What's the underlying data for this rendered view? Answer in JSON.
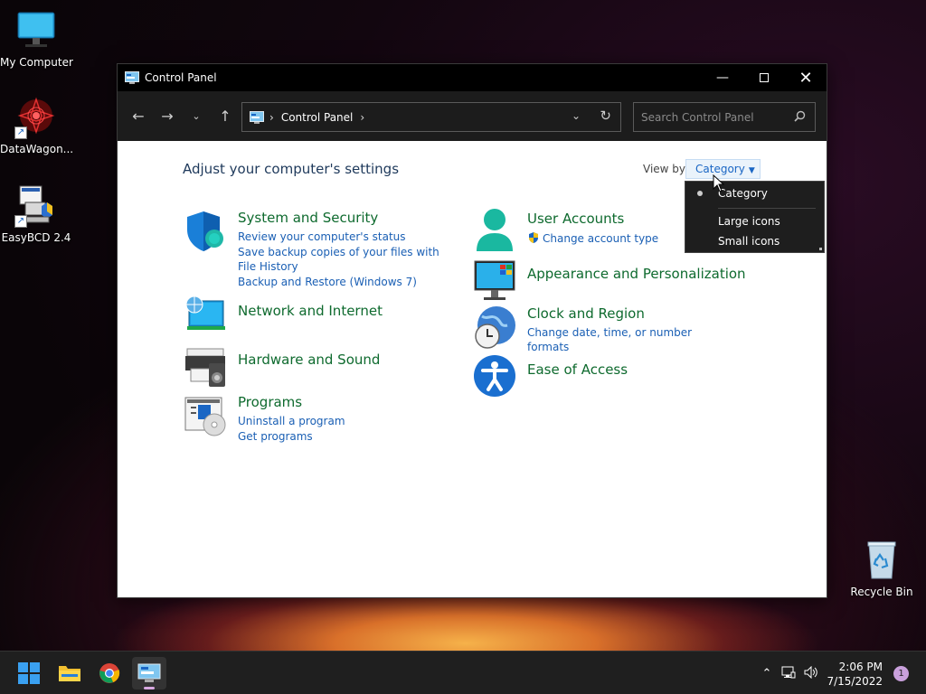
{
  "desktop": {
    "icons": [
      {
        "label": "My Computer"
      },
      {
        "label": "DataWagon..."
      },
      {
        "label": "EasyBCD 2.4"
      },
      {
        "label": "Recycle Bin"
      }
    ]
  },
  "window": {
    "title": "Control Panel",
    "address": {
      "crumb": "Control Panel"
    },
    "search": {
      "placeholder": "Search Control Panel"
    },
    "heading": "Adjust your computer's settings",
    "view_by": {
      "label": "View by:",
      "selected": "Category"
    },
    "categories": [
      {
        "title": "System and Security",
        "icon": "shield-icon",
        "links": [
          "Review your computer's status",
          "Save backup copies of your files with File History",
          "Backup and Restore (Windows 7)"
        ]
      },
      {
        "title": "Network and Internet",
        "icon": "network-globe-icon",
        "links": []
      },
      {
        "title": "Hardware and Sound",
        "icon": "printer-speaker-icon",
        "links": []
      },
      {
        "title": "Programs",
        "icon": "programs-disc-icon",
        "links": [
          "Uninstall a program",
          "Get programs"
        ]
      },
      {
        "title": "User Accounts",
        "icon": "user-icon",
        "links": [
          "Change account type"
        ]
      },
      {
        "title": "Appearance and Personalization",
        "icon": "monitor-palette-icon",
        "links": []
      },
      {
        "title": "Clock and Region",
        "icon": "clock-globe-icon",
        "links": [
          "Change date, time, or number formats"
        ]
      },
      {
        "title": "Ease of Access",
        "icon": "accessibility-icon",
        "links": []
      }
    ]
  },
  "view_menu": {
    "items": [
      "Category",
      "Large icons",
      "Small icons"
    ],
    "selected_index": 0
  },
  "taskbar": {
    "clock": {
      "time": "2:06 PM",
      "date": "7/15/2022"
    },
    "notifications": "1"
  },
  "colors": {
    "link": "#1a5fb4",
    "category_title": "#0e6a2e",
    "heading": "#1e395b",
    "titlebar": "#000000",
    "navbar": "#1c1c1c"
  }
}
